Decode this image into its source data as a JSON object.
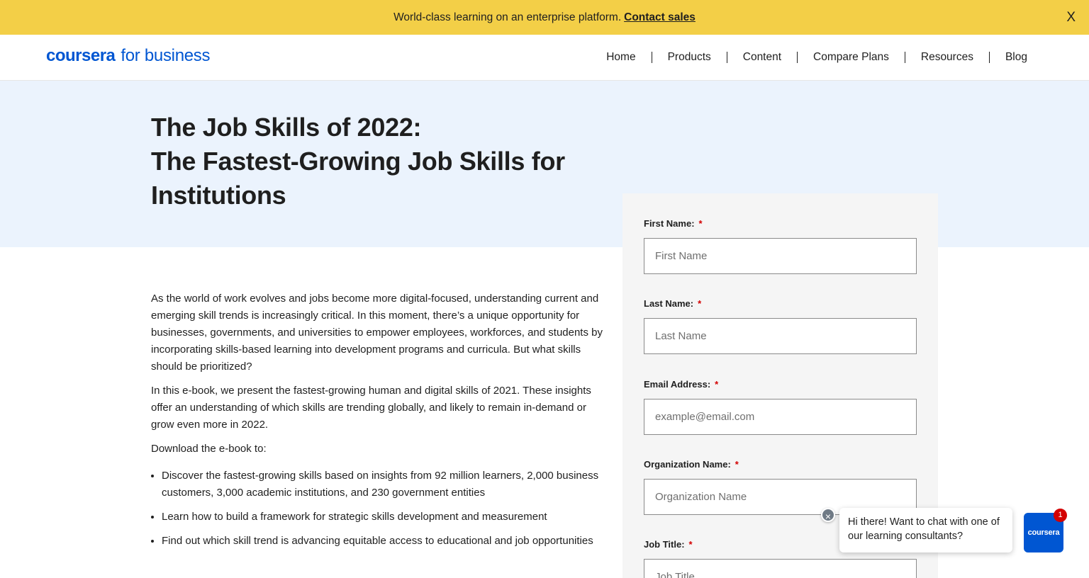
{
  "banner": {
    "text": "World-class learning on an enterprise platform.",
    "link": "Contact sales",
    "close": "X"
  },
  "header": {
    "logo_main": "coursera",
    "logo_sub": "for business",
    "nav": [
      "Home",
      "Products",
      "Content",
      "Compare Plans",
      "Resources",
      "Blog"
    ]
  },
  "hero": {
    "title_lines": [
      "The Job Skills of 2022:",
      "The Fastest-Growing Job Skills for",
      "Institutions"
    ]
  },
  "content": {
    "paragraphs": [
      "As the world of work evolves and jobs become more digital-focused, understanding current and emerging skill trends is increasingly critical. In this moment, there’s a unique opportunity for businesses, governments, and universities to empower employees, workforces, and students by incorporating skills-based learning into development programs and curricula. But what skills should be prioritized?",
      "In this e-book, we present the fastest-growing human and digital skills of 2021. These insights offer an understanding of which skills are trending globally, and likely to remain in-demand or grow even more in 2022.",
      "Download the e-book to:"
    ],
    "bullets": [
      "Discover the fastest-growing skills based on insights from 92 million learners, 2,000 business customers, 3,000 academic institutions, and 230 government entities",
      "Learn how to build a framework for strategic skills development and measurement",
      "Find out which skill trend is advancing equitable access to educational and job opportunities"
    ]
  },
  "form": {
    "required_mark": "*",
    "fields": [
      {
        "label": "First Name:",
        "placeholder": "First Name"
      },
      {
        "label": "Last Name:",
        "placeholder": "Last Name"
      },
      {
        "label": "Email Address:",
        "placeholder": "example@email.com"
      },
      {
        "label": "Organization Name:",
        "placeholder": "Organization Name"
      },
      {
        "label": "Job Title:",
        "placeholder": "Job Title"
      }
    ]
  },
  "chat": {
    "message": "Hi there! Want to chat with one of our learning consultants?",
    "close_icon": "×",
    "launcher_label": "coursera",
    "badge_count": "1"
  },
  "colors": {
    "banner_bg": "#f3cf47",
    "brand_blue": "#0056d2",
    "hero_bg": "#ebf3fd",
    "required_red": "#d30001"
  }
}
